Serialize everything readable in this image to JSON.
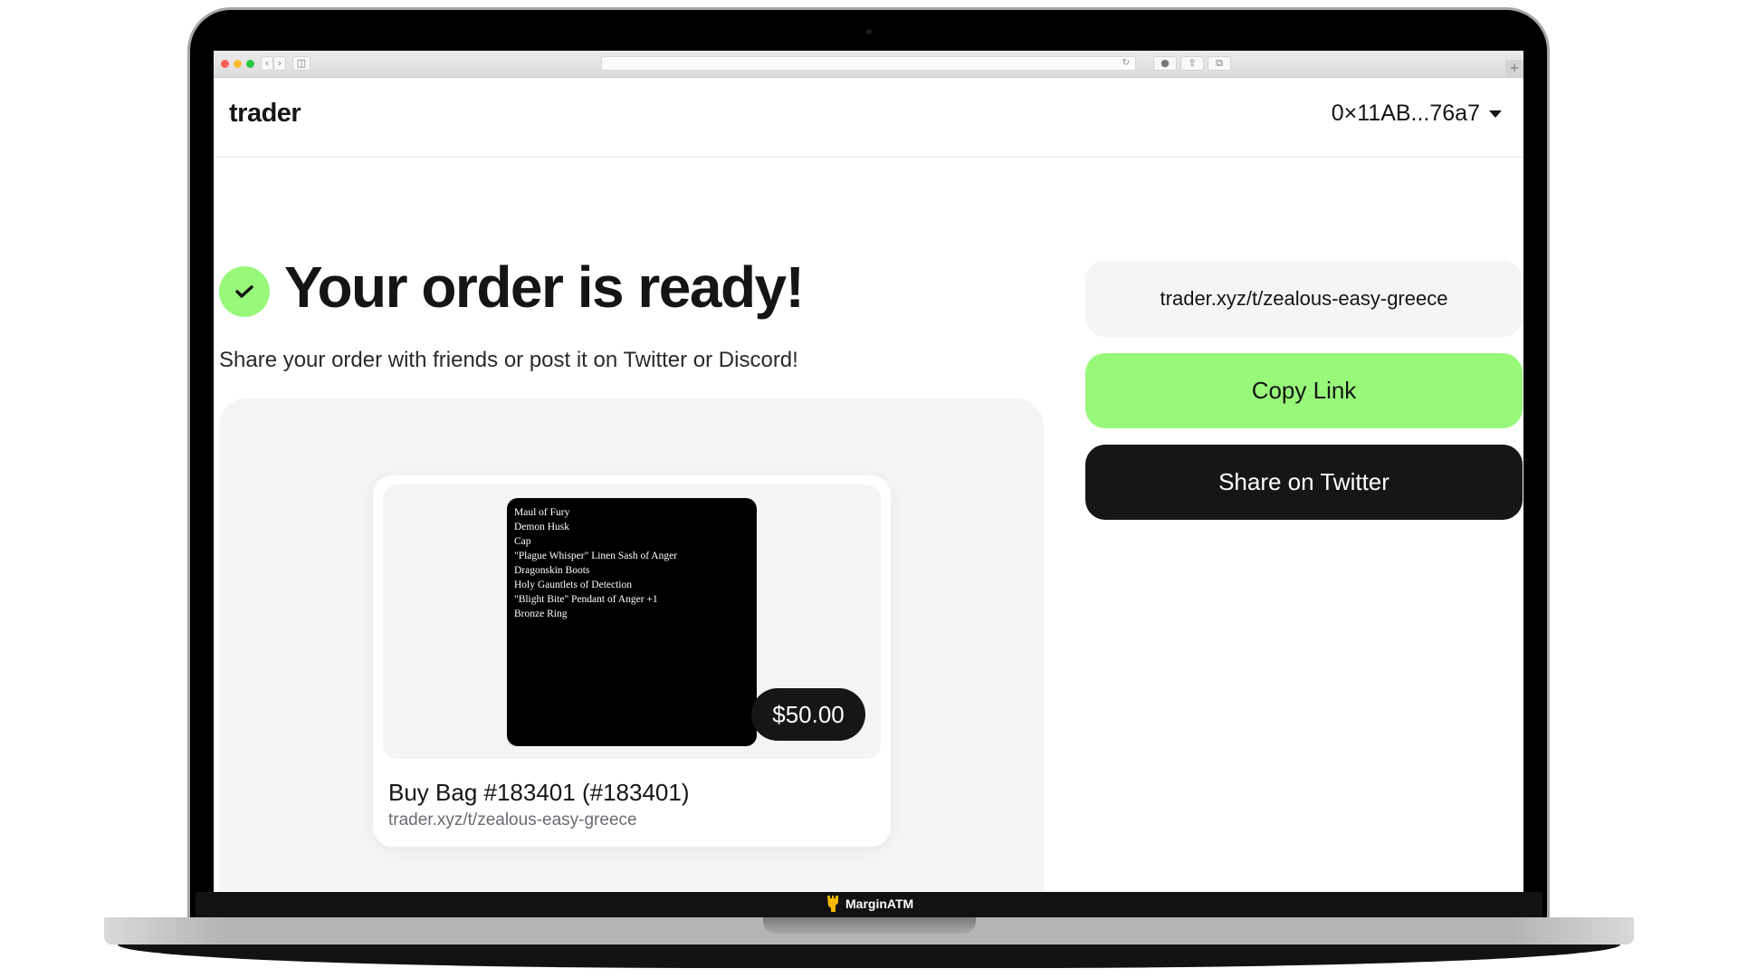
{
  "browser": {
    "address_value": "",
    "back_icon": "chevron-left",
    "forward_icon": "chevron-right",
    "sidebar_icon": "sidebar",
    "reload_icon": "reload",
    "download_icon": "download",
    "share_icon": "share",
    "tabs_icon": "tabs",
    "new_tab_label": "+"
  },
  "header": {
    "logo": "trader",
    "wallet_address": "0×11AB...76a7"
  },
  "main": {
    "title": "Your order is ready!",
    "subtitle": "Share your order with friends or post it on Twitter or Discord!",
    "order_card": {
      "items": [
        "Maul of Fury",
        "Demon Husk",
        "Cap",
        "\"Plague Whisper\" Linen Sash of Anger",
        "Dragonskin Boots",
        "Holy Gauntlets of Detection",
        "\"Blight Bite\" Pendant of Anger +1",
        "Bronze Ring"
      ],
      "price": "$50.00",
      "title": "Buy Bag #183401 (#183401)",
      "url": "trader.xyz/t/zealous-easy-greece"
    }
  },
  "share": {
    "link": "trader.xyz/t/zealous-easy-greece",
    "copy_label": "Copy Link",
    "twitter_label": "Share on Twitter"
  },
  "dock": {
    "app_name": "MarginATM"
  },
  "colors": {
    "accent_green": "#98f87a",
    "dark": "#161616"
  }
}
